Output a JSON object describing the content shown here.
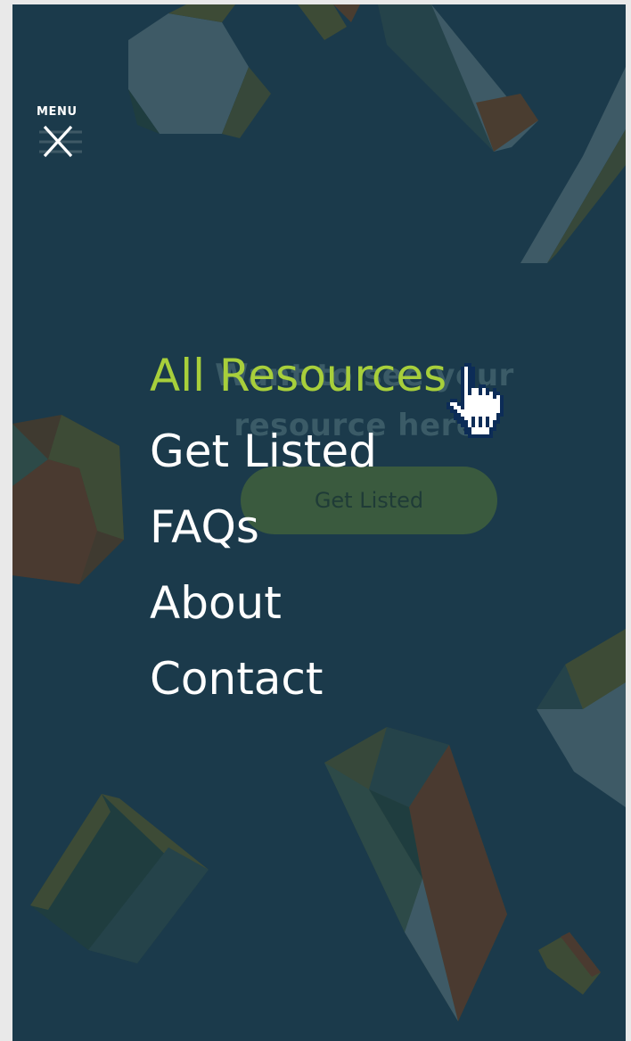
{
  "menu": {
    "label": "MENU",
    "toggle_icon": "close-icon"
  },
  "nav": {
    "items": [
      {
        "label": "All Resources",
        "active": true
      },
      {
        "label": "Get Listed",
        "active": false
      },
      {
        "label": "FAQs",
        "active": false
      },
      {
        "label": "About",
        "active": false
      },
      {
        "label": "Contact",
        "active": false
      }
    ]
  },
  "underlying_page": {
    "heading_line1": "Want to see your",
    "heading_line2": "resource here?",
    "cta_label": "Get Listed"
  },
  "colors": {
    "background": "#1b3a4b",
    "accent": "#a8cf3b",
    "text": "#ffffff"
  },
  "cursor": "hand-pointer-icon"
}
